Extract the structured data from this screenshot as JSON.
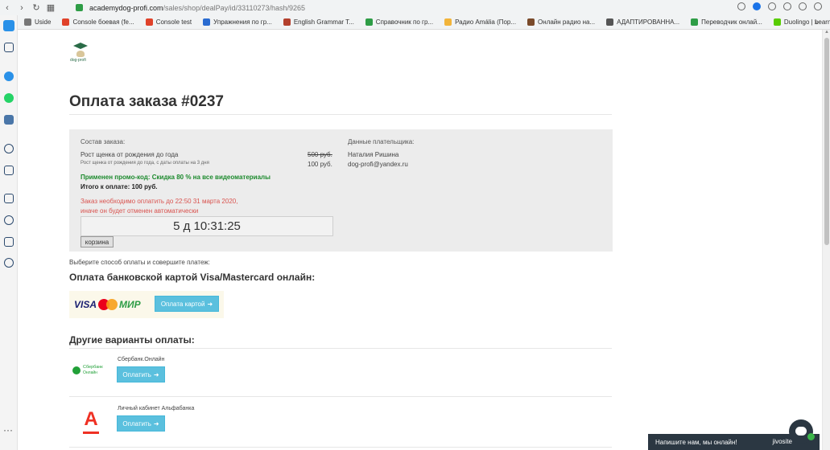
{
  "browser": {
    "url_host": "academydog-profi.com",
    "url_path": "/sales/shop/dealPay/id/33110273/hash/9265",
    "bookmarks": [
      {
        "label": "Uside",
        "color": "#777777"
      },
      {
        "label": "Console боевая (fe...",
        "color": "#e0422a"
      },
      {
        "label": "Console test",
        "color": "#e0422a"
      },
      {
        "label": "Упражнения по гр...",
        "color": "#2a6cd1"
      },
      {
        "label": "English Grammar T...",
        "color": "#b3402d"
      },
      {
        "label": "Справочник по гр...",
        "color": "#2e9d46"
      },
      {
        "label": "Радио Amália (Пор...",
        "color": "#f2b43a"
      },
      {
        "label": "Онлайн радио на...",
        "color": "#7a4a2a"
      },
      {
        "label": "АДАПТИРОВАННА...",
        "color": "#555555"
      },
      {
        "label": "Переводчик онлай...",
        "color": "#2e9d46"
      },
      {
        "label": "Duolingo | Learn Po...",
        "color": "#58cc02"
      }
    ]
  },
  "header": {
    "logo_text": "dog-profi",
    "title": "Оплата заказа #0237"
  },
  "order": {
    "composition_label": "Состав заказа:",
    "item_name": "Рост щенка от рождения до года",
    "item_sub": "Рост щенка от рождения до года, с даты оплаты на 3 дня",
    "old_price": "500 руб.",
    "new_price": "100 руб.",
    "payer_label": "Данные плательщика:",
    "payer_name": "Наталия Ришина",
    "payer_email": "dog-profi@yandex.ru",
    "promo": "Применен промо-код: Скидка 80 % на все видеоматериалы",
    "total": "Итого к оплате: 100 руб.",
    "deadline_line1": "Заказ необходимо оплатить до 22:50 31 марта 2020,",
    "deadline_line2": "иначе он будет отменен автоматически",
    "timer": "5 д 10:31:25",
    "cart_button": "корзина"
  },
  "payment": {
    "choose_text": "Выберите способ оплаты и совершите платеж:",
    "card_heading": "Оплата банковской картой Visa/Mastercard онлайн:",
    "card_logos": {
      "visa": "VISA",
      "mir": "МИР"
    },
    "card_button": "Оплата картой",
    "other_heading": "Другие варианты оплаты:",
    "methods": [
      {
        "name": "Сбербанк.Онлайн",
        "logo_line1": "Сбербанк",
        "logo_line2": "Онлайн",
        "button": "Оплатить"
      },
      {
        "name": "Личный кабинет Альфабанка",
        "logo_letter": "А",
        "button": "Оплатить"
      }
    ]
  },
  "chat": {
    "text": "Напишите нам, мы онлайн!",
    "brand": "jivosite"
  }
}
